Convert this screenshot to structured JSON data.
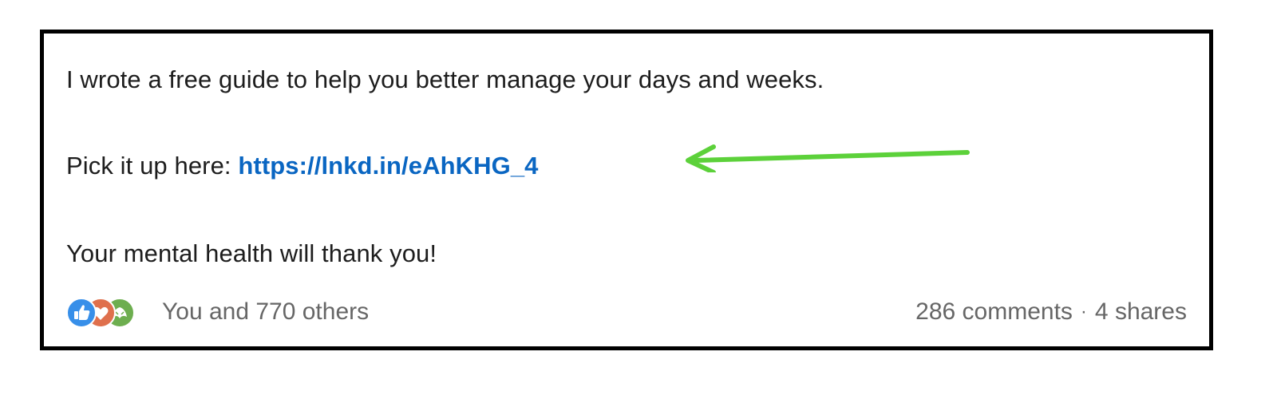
{
  "post": {
    "line1": "I wrote a free guide to help you better manage your days and weeks.",
    "line2_prefix": "Pick it up here: ",
    "link_text": "https://lnkd.in/eAhKHG_4",
    "line3": "Your mental health will thank you!"
  },
  "social": {
    "reactions_text": "You and 770 others",
    "comments": "286 comments",
    "separator": "·",
    "shares": "4 shares",
    "reaction_icons": [
      "like-icon",
      "love-icon",
      "support-icon"
    ]
  },
  "annotation": {
    "arrow_color": "#5cd13a",
    "arrow_icon": "arrow-left-icon"
  },
  "colors": {
    "link": "#0a66c2",
    "text": "#1d1d1d",
    "muted": "#666666",
    "frame": "#000000"
  }
}
